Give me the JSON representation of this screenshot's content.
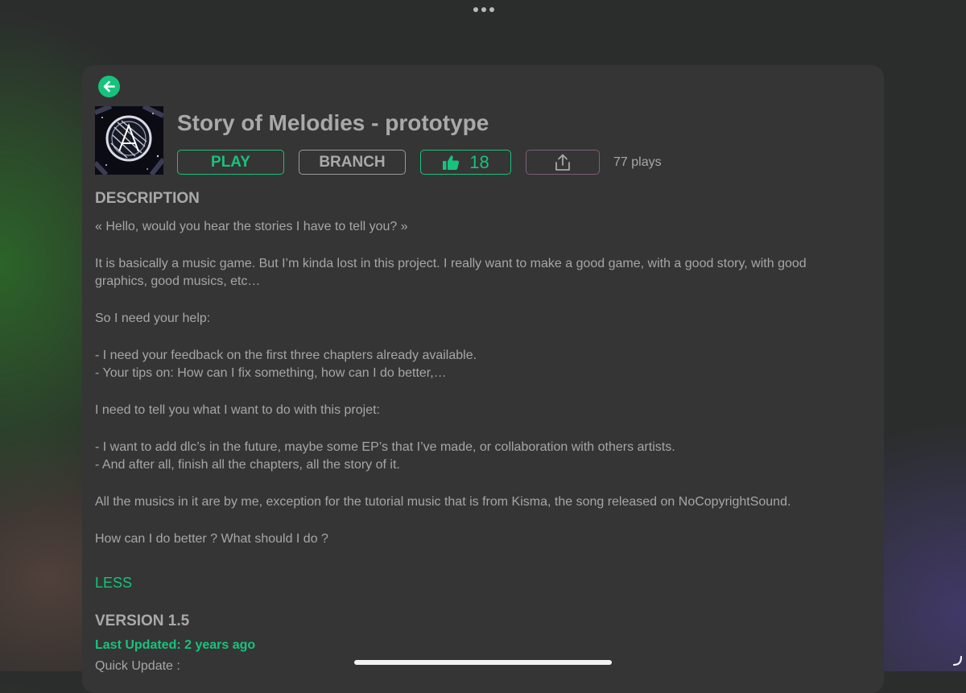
{
  "game": {
    "title": "Story of Melodies - prototype",
    "plays": "77 plays"
  },
  "actions": {
    "play_label": "PLAY",
    "branch_label": "BRANCH",
    "like_count": "18"
  },
  "description": {
    "heading": "DESCRIPTION",
    "paragraphs": [
      "« Hello, would you hear the stories I have to tell you? »",
      "It is basically a music game. But I’m kinda lost in this project. I really want to make a good game, with a good story, with good graphics, good musics, etc…",
      "So I need your help:",
      "- I need your feedback on the first three chapters already available.\n- Your tips on: How can I fix something, how can I do better,…",
      "I need to tell you what I want to do with this projet:",
      "- I want to add dlc’s in the future, maybe some EP’s that I’ve made, or collaboration with others artists.\n- And after all, finish all the chapters, all the story of it.",
      "All the musics in it are by me, exception for the tutorial music that is from Kisma, the song released on NoCopyrightSound.",
      "How can I do better ? What should I do ?"
    ],
    "toggle_label": "LESS"
  },
  "version": {
    "heading": "VERSION 1.5",
    "last_updated": "Last Updated: 2 years ago",
    "quick_update": "Quick Update :"
  },
  "colors": {
    "accent": "#17c37c",
    "panel": "#353535",
    "text": "#a6a6a6",
    "share_border": "#7d5d79"
  },
  "icons": {
    "back": "arrow-left-icon",
    "like": "thumbs-up-icon",
    "share": "share-upload-icon",
    "menu": "more-dots-icon"
  }
}
